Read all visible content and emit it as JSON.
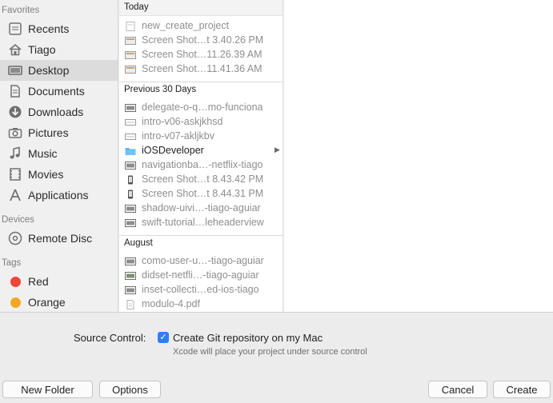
{
  "sidebar": {
    "favorites_header": "Favorites",
    "devices_header": "Devices",
    "tags_header": "Tags",
    "favorites": [
      {
        "label": "Recents",
        "icon": "recents-icon"
      },
      {
        "label": "Tiago",
        "icon": "home-icon"
      },
      {
        "label": "Desktop",
        "icon": "desktop-icon",
        "selected": true
      },
      {
        "label": "Documents",
        "icon": "documents-icon"
      },
      {
        "label": "Downloads",
        "icon": "downloads-icon"
      },
      {
        "label": "Pictures",
        "icon": "camera-icon"
      },
      {
        "label": "Music",
        "icon": "music-note-icon"
      },
      {
        "label": "Movies",
        "icon": "film-icon"
      },
      {
        "label": "Applications",
        "icon": "applications-icon"
      }
    ],
    "devices": [
      {
        "label": "Remote Disc",
        "icon": "disc-icon"
      }
    ],
    "tags": [
      {
        "label": "Red",
        "color": "#f0453a"
      },
      {
        "label": "Orange",
        "color": "#f5a623"
      }
    ]
  },
  "files": {
    "groups": [
      {
        "header": "Today",
        "items": [
          {
            "name": "new_create_project",
            "icon": "document-icon"
          },
          {
            "name": "Screen Shot…t 3.40.26 PM",
            "icon": "screenshot-icon"
          },
          {
            "name": "Screen Shot…11.26.39 AM",
            "icon": "screenshot-icon"
          },
          {
            "name": "Screen Shot…11.41.36 AM",
            "icon": "screenshot-icon"
          }
        ]
      },
      {
        "header": "Previous 30 Days",
        "items": [
          {
            "name": "delegate-o-q…mo-funciona",
            "icon": "image-file-icon"
          },
          {
            "name": "intro-v06-askjkhsd",
            "icon": "video-file-icon"
          },
          {
            "name": "intro-v07-akljkbv",
            "icon": "video-file-icon"
          },
          {
            "name": "iOSDeveloper",
            "icon": "folder-icon",
            "folder": true
          },
          {
            "name": "navigationba…-netflix-tiago",
            "icon": "image-file-icon"
          },
          {
            "name": "Screen Shot…t 8.43.42 PM",
            "icon": "phone-screenshot-icon"
          },
          {
            "name": "Screen Shot…t 8.44.31 PM",
            "icon": "phone-screenshot-icon"
          },
          {
            "name": "shadow-uivi…-tiago-aguiar",
            "icon": "image-file-icon"
          },
          {
            "name": "swift-tutorial…leheaderview",
            "icon": "image-file-icon"
          }
        ]
      },
      {
        "header": "August",
        "items": [
          {
            "name": "como-user-u…-tiago-aguiar",
            "icon": "image-file-icon"
          },
          {
            "name": "didset-netfli…-tiago-aguiar",
            "icon": "image-file-icon"
          },
          {
            "name": "inset-collecti…ed-ios-tiago",
            "icon": "image-file-icon"
          },
          {
            "name": "modulo-4.pdf",
            "icon": "pdf-icon"
          }
        ]
      }
    ]
  },
  "source_control": {
    "label": "Source Control:",
    "checkbox_label": "Create Git repository on my Mac",
    "checked": true,
    "hint": "Xcode will place your project under source control"
  },
  "buttons": {
    "new_folder": "New Folder",
    "options": "Options",
    "cancel": "Cancel",
    "create": "Create"
  },
  "colors": {
    "accent": "#2f7ef5",
    "folder": "#5ab4f2"
  }
}
